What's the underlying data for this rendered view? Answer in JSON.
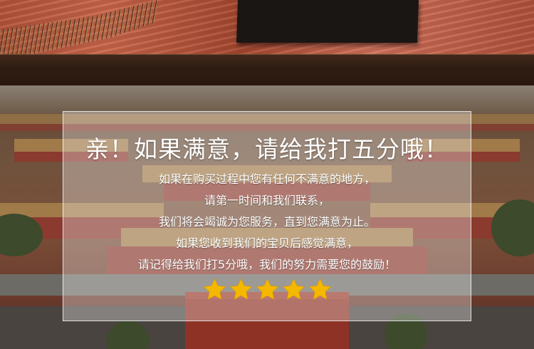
{
  "colors": {
    "panel_text": "#ffffff",
    "star": "#f5b800",
    "band": "#2f1c12"
  },
  "promo": {
    "headline": "亲！如果满意，请给我打五分哦！",
    "lines": [
      "如果在购买过程中您有任何不满意的地方，",
      "请第一时间和我们联系，",
      "我们将会竭诚为您服务，直到您满意为止。",
      "如果您收到我们的宝贝后感觉满意，",
      "请记得给我们打5分哦，我们的努力需要您的鼓励！"
    ],
    "rating": {
      "filled": 5,
      "max": 5,
      "icon": "star-icon"
    }
  }
}
